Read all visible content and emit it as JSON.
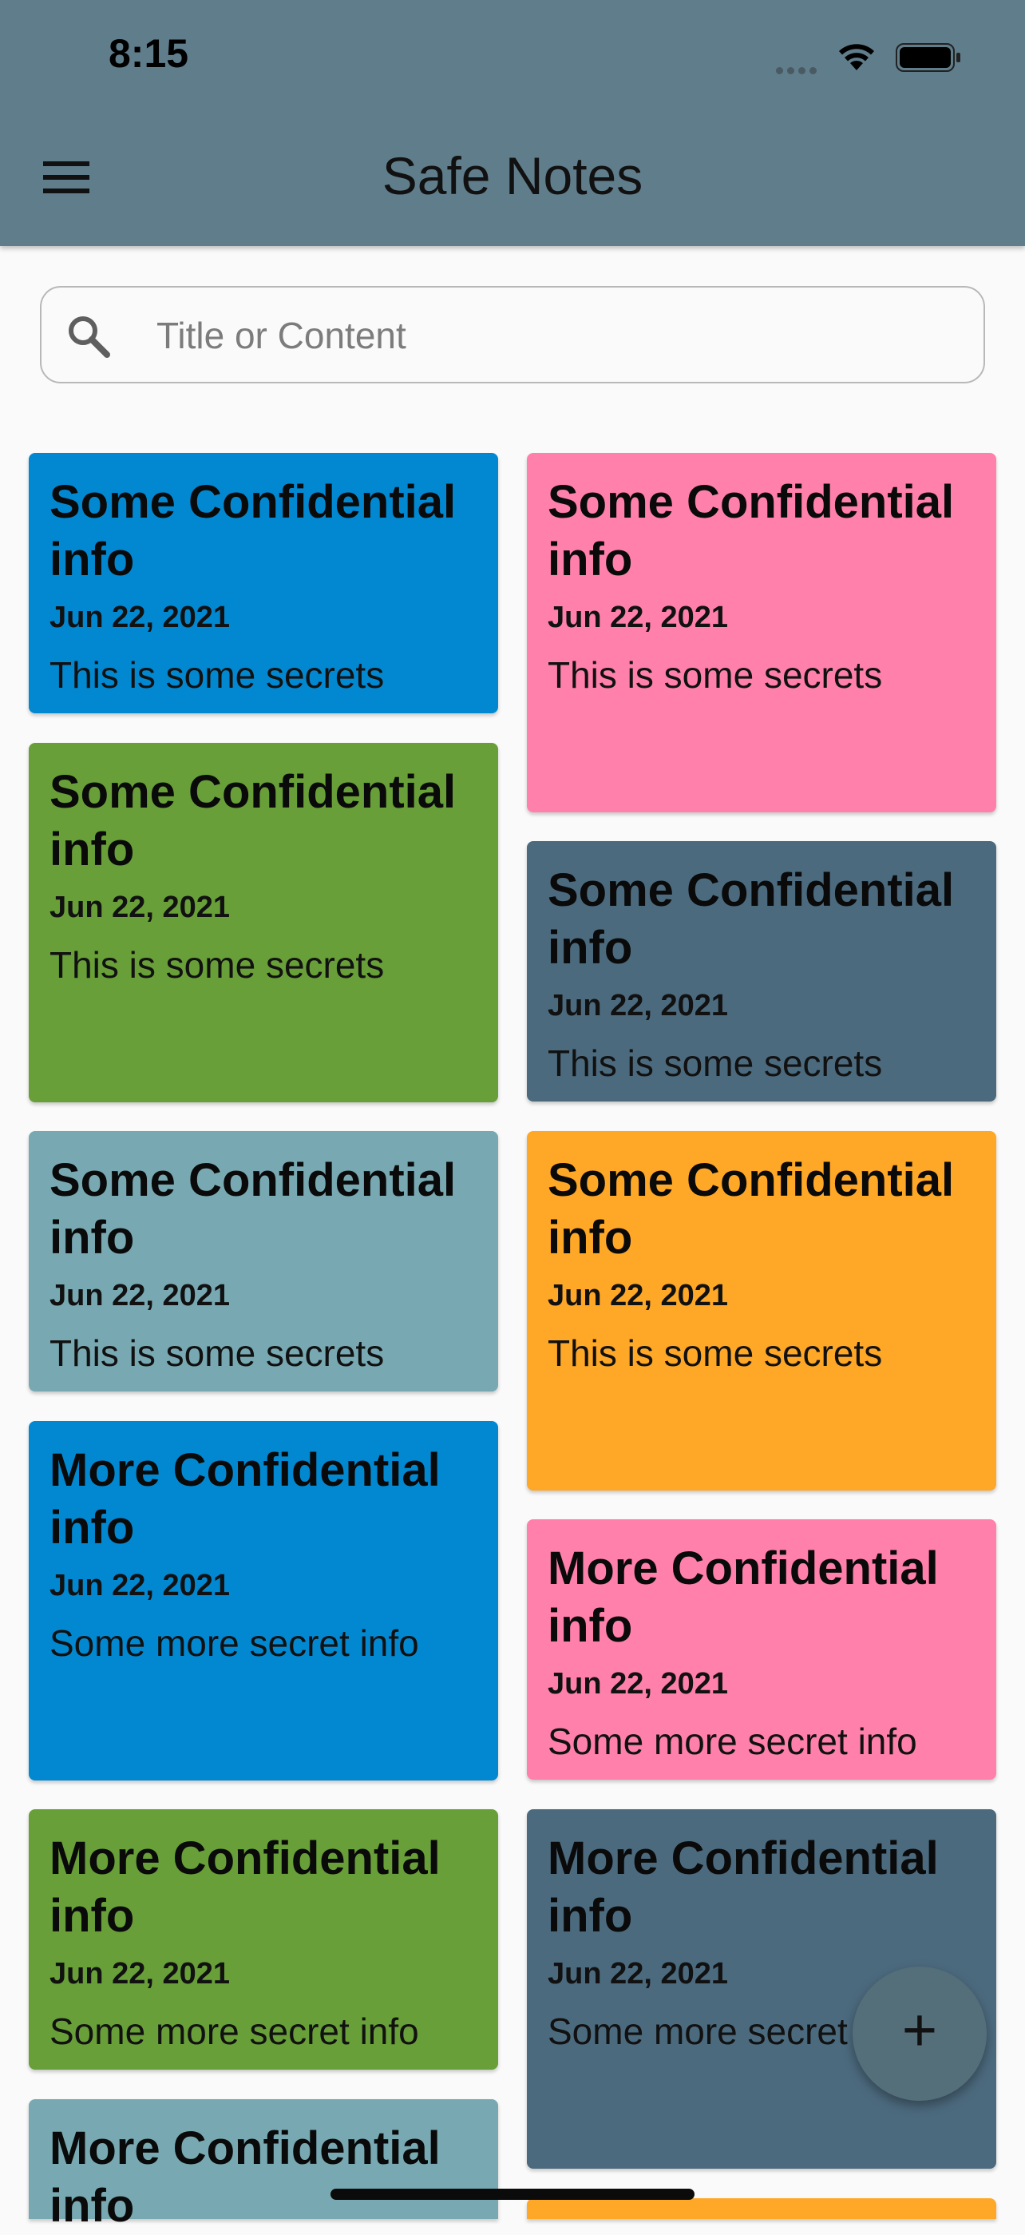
{
  "status_bar": {
    "time": "8:15"
  },
  "app_bar": {
    "title": "Safe Notes",
    "menu_icon": "menu-icon"
  },
  "search": {
    "placeholder": "Title or Content",
    "value": ""
  },
  "notes": [
    {
      "title": "Some Confidential info",
      "date": "Jun 22, 2021",
      "content": "This is some secrets",
      "color": "#0288d1"
    },
    {
      "title": "Some Confidential info",
      "date": "Jun 22, 2021",
      "content": "This is some secrets",
      "color": "#ff80ab"
    },
    {
      "title": "Some Confidential info",
      "date": "Jun 22, 2021",
      "content": "This is some secrets",
      "color": "#689f38"
    },
    {
      "title": "Some Confidential info",
      "date": "Jun 22, 2021",
      "content": "This is some secrets",
      "color": "#4c6a7e"
    },
    {
      "title": "Some Confidential info",
      "date": "Jun 22, 2021",
      "content": "This is some secrets",
      "color": "#78a9b2"
    },
    {
      "title": "Some Confidential info",
      "date": "Jun 22, 2021",
      "content": "This is some secrets",
      "color": "#ffa726"
    },
    {
      "title": "More Confidential info",
      "date": "Jun 22, 2021",
      "content": "Some more secret info",
      "color": "#0288d1"
    },
    {
      "title": "More Confidential info",
      "date": "Jun 22, 2021",
      "content": "Some more secret info",
      "color": "#ff80ab"
    },
    {
      "title": "More Confidential info",
      "date": "Jun 22, 2021",
      "content": "Some more secret info",
      "color": "#689f38"
    },
    {
      "title": "More Confidential info",
      "date": "Jun 22, 2021",
      "content": "Some more secret info",
      "color": "#4c6a7e"
    },
    {
      "title": "More Confidential info",
      "date": "",
      "content": "",
      "color": "#78a9b2"
    },
    {
      "title": "",
      "date": "",
      "content": "",
      "color": "#ffa726"
    }
  ],
  "fab": {
    "icon": "plus-icon",
    "label": "+"
  }
}
